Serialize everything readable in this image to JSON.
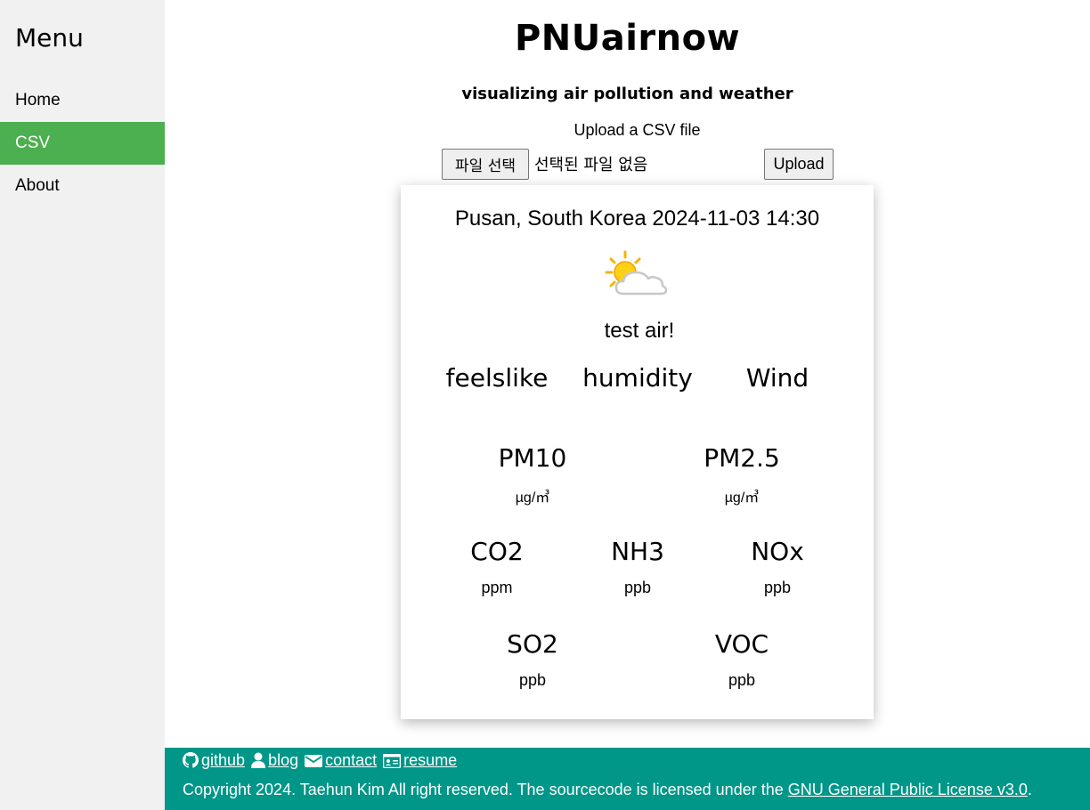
{
  "sidebar": {
    "title": "Menu",
    "items": [
      {
        "label": "Home"
      },
      {
        "label": "CSV"
      },
      {
        "label": "About"
      }
    ]
  },
  "header": {
    "title": "PNUairnow",
    "subtitle": "visualizing air pollution and weather"
  },
  "upload": {
    "label": "Upload a CSV file",
    "choose_button": "파일 선택",
    "no_file_text": "선택된 파일 없음",
    "upload_button": "Upload"
  },
  "card": {
    "location_time": "Pusan, South Korea 2024-11-03 14:30",
    "weather_icon": "partly-cloudy-icon",
    "description": "test air!",
    "weather_metrics": [
      {
        "label": "feelslike"
      },
      {
        "label": "humidity"
      },
      {
        "label": "Wind"
      }
    ],
    "pollutants": [
      {
        "label": "PM10",
        "unit": "µg/㎥"
      },
      {
        "label": "PM2.5",
        "unit": "µg/㎥"
      },
      {
        "label": "CO2",
        "unit": "ppm"
      },
      {
        "label": "NH3",
        "unit": "ppb"
      },
      {
        "label": "NOx",
        "unit": "ppb"
      },
      {
        "label": "SO2",
        "unit": "ppb"
      },
      {
        "label": "VOC",
        "unit": "ppb"
      }
    ]
  },
  "footer": {
    "links": [
      {
        "label": "github",
        "icon": "github-icon"
      },
      {
        "label": "blog",
        "icon": "user-icon"
      },
      {
        "label": "contact",
        "icon": "envelope-icon"
      },
      {
        "label": "resume",
        "icon": "id-card-icon"
      }
    ],
    "copyright": "Copyright 2024. Taehun Kim All right reserved. The sourcecode is licensed under the ",
    "license_link": "GNU General Public License v3.0",
    "copyright_end": ".",
    "color": "#009688"
  },
  "colors": {
    "active_menu": "#4caf50",
    "sidebar_bg": "#f1f1f1"
  }
}
